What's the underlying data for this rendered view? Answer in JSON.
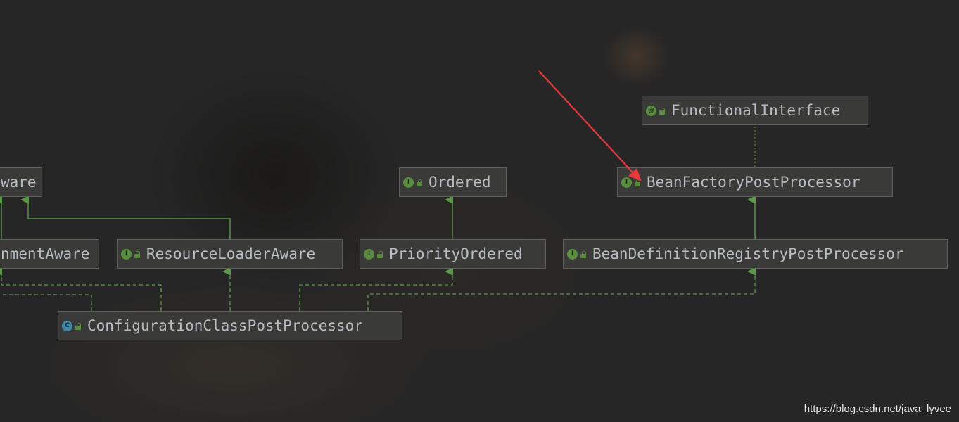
{
  "nodes": {
    "env_aware_top": {
      "label": "ware",
      "kind": "interface"
    },
    "ordered": {
      "label": "Ordered",
      "kind": "interface"
    },
    "bean_factory_post_processor": {
      "label": "BeanFactoryPostProcessor",
      "kind": "interface"
    },
    "functional_interface": {
      "label": "FunctionalInterface",
      "kind": "annotation"
    },
    "environment_aware": {
      "label": "nmentAware",
      "kind": "interface"
    },
    "resource_loader_aware": {
      "label": "ResourceLoaderAware",
      "kind": "interface"
    },
    "priority_ordered": {
      "label": "PriorityOrdered",
      "kind": "interface"
    },
    "bean_definition_registry_post_processor": {
      "label": "BeanDefinitionRegistryPostProcessor",
      "kind": "interface"
    },
    "configuration_class_post_processor": {
      "label": "ConfigurationClassPostProcessor",
      "kind": "class"
    }
  },
  "badges": {
    "interface": "I",
    "class": "C",
    "annotation": "@"
  },
  "colors": {
    "background": "#262626",
    "node_fill": "#3a3b39",
    "node_border": "#5f5f5f",
    "node_text": "#b9bcc0",
    "edge": "#5a9a45",
    "interface_badge": "#5a8d3e",
    "class_badge": "#3f88a8",
    "annotation_arrow": "#e8383b"
  },
  "watermark": "https://blog.csdn.net/java_lyvee"
}
